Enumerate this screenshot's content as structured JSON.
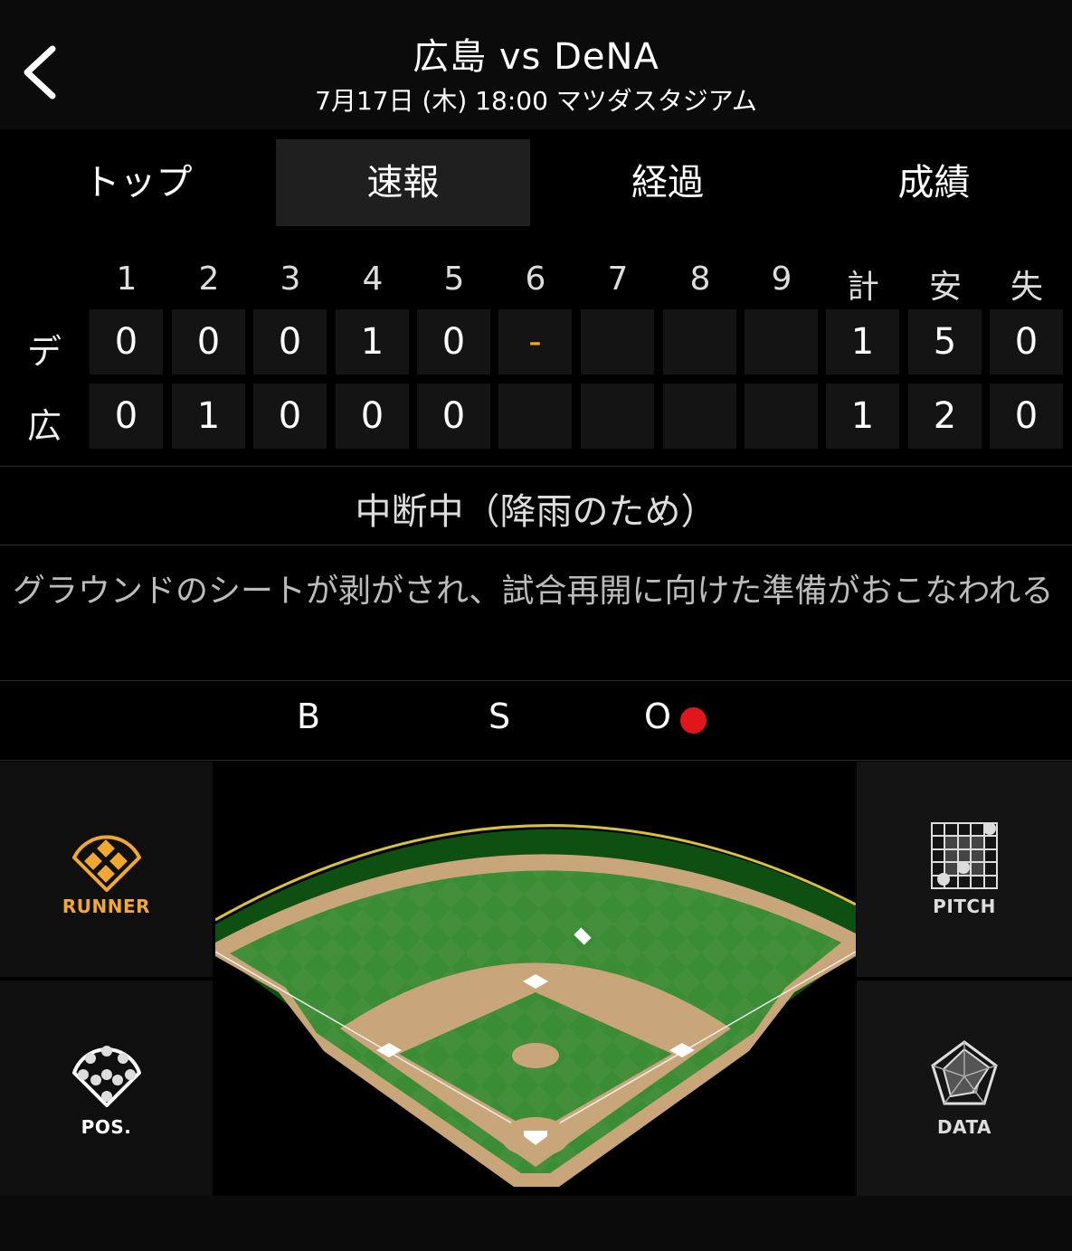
{
  "header": {
    "title": "広島 vs DeNA",
    "subtitle": "7月17日 (木) 18:00 マツダスタジアム"
  },
  "tabs": [
    {
      "label": "トップ",
      "active": false
    },
    {
      "label": "速報",
      "active": true
    },
    {
      "label": "経過",
      "active": false
    },
    {
      "label": "成績",
      "active": false
    }
  ],
  "scoreboard": {
    "headers": [
      "1",
      "2",
      "3",
      "4",
      "5",
      "6",
      "7",
      "8",
      "9",
      "計",
      "安",
      "失"
    ],
    "rows": [
      {
        "team": "デ",
        "cells": [
          "0",
          "0",
          "0",
          "1",
          "0",
          "-",
          "",
          "",
          "",
          "1",
          "5",
          "0"
        ]
      },
      {
        "team": "広",
        "cells": [
          "0",
          "1",
          "0",
          "0",
          "0",
          "",
          "",
          "",
          "",
          "1",
          "2",
          "0"
        ]
      }
    ],
    "pending_color": "#f5a623"
  },
  "status": "中断中（降雨のため）",
  "comment": "グラウンドのシートが剥がされ、試合再開に向けた準備がおこなわれる",
  "count": {
    "ball_label": "B",
    "strike_label": "S",
    "out_label": "O",
    "balls": 0,
    "strikes": 0,
    "outs": 1,
    "out_color": "#e0161b"
  },
  "panels": {
    "runner": {
      "label": "RUNNER",
      "icon": "runner-diamond-icon",
      "color": "#f0a830"
    },
    "pos": {
      "label": "POS.",
      "icon": "positions-icon"
    },
    "pitch": {
      "label": "PITCH",
      "icon": "pitch-grid-icon"
    },
    "data": {
      "label": "DATA",
      "icon": "radar-chart-icon"
    }
  }
}
